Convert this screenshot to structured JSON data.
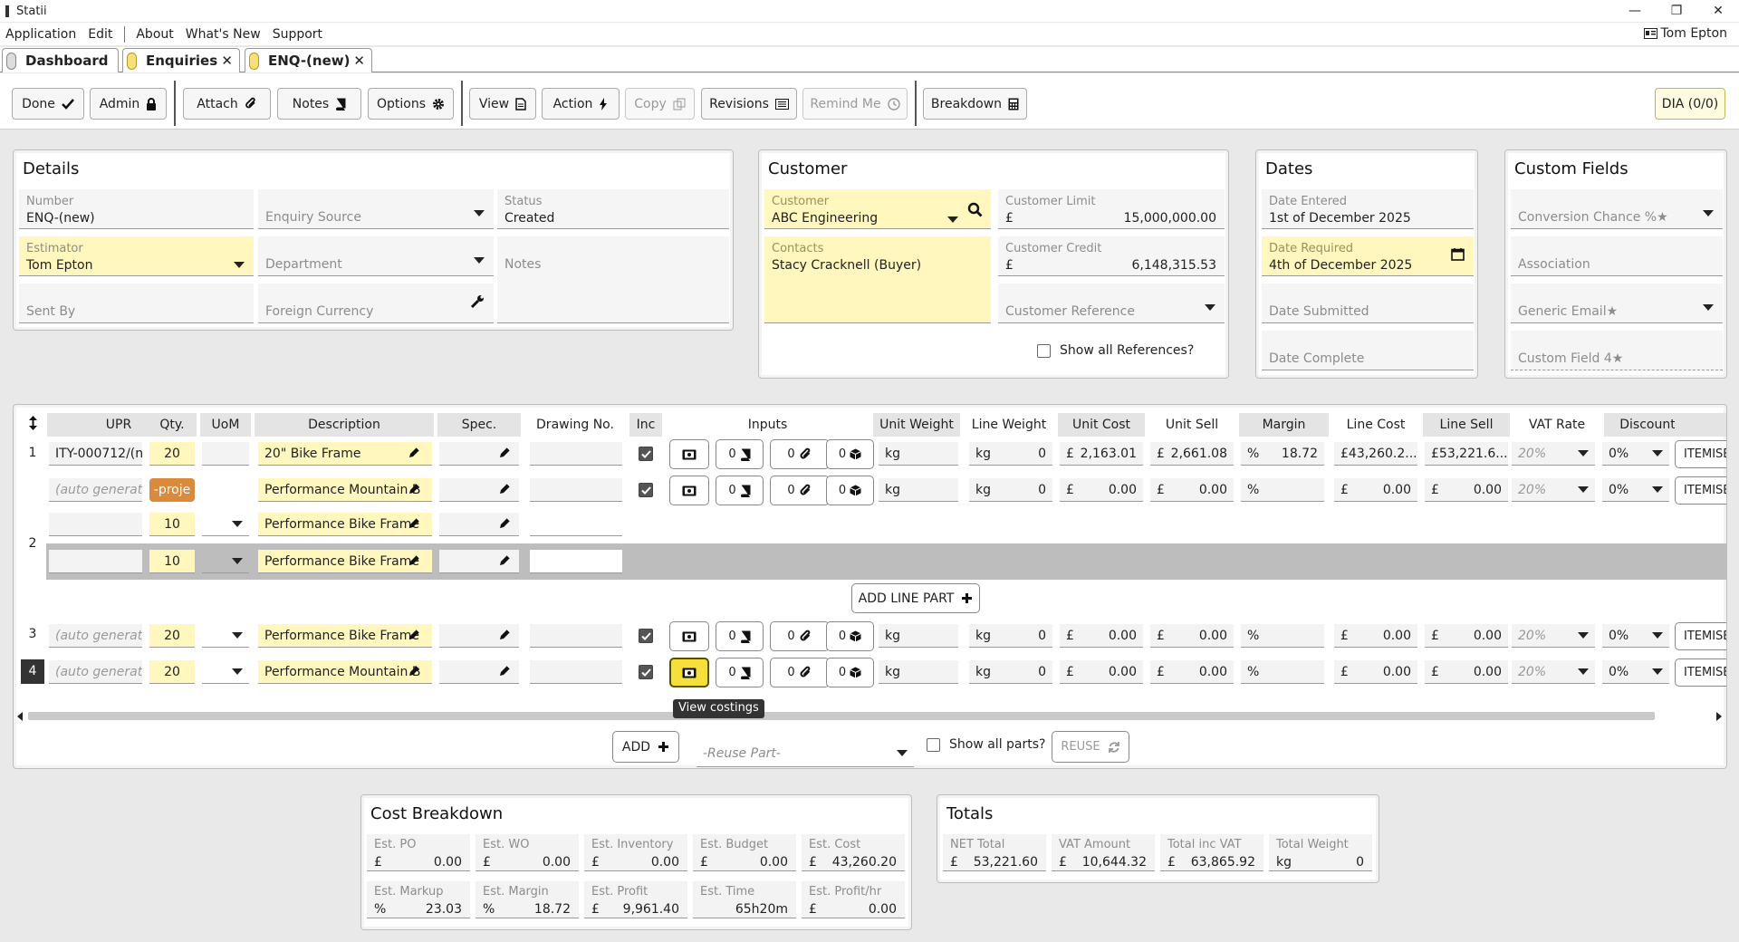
{
  "window": {
    "title": "Statii"
  },
  "menu": {
    "items": [
      "Application",
      "Edit",
      "About",
      "What's New",
      "Support"
    ],
    "user": "Tom Epton"
  },
  "tabs": [
    {
      "label": "Dashboard"
    },
    {
      "label": "Enquiries"
    },
    {
      "label": "ENQ-(new)"
    }
  ],
  "toolbar": {
    "done": "Done",
    "admin": "Admin",
    "attach": "Attach",
    "notes": "Notes",
    "options": "Options",
    "view": "View",
    "action": "Action",
    "copy": "Copy",
    "revisions": "Revisions",
    "remind": "Remind Me",
    "breakdown": "Breakdown",
    "dia": "DIA (0/0)"
  },
  "details": {
    "title": "Details",
    "number_label": "Number",
    "number": "ENQ-(new)",
    "source_ph": "Enquiry Source",
    "status_label": "Status",
    "status": "Created",
    "estimator_label": "Estimator",
    "estimator": "Tom Epton",
    "department_ph": "Department",
    "notes_ph": "Notes",
    "sentby_ph": "Sent By",
    "currency_ph": "Foreign Currency"
  },
  "customer": {
    "title": "Customer",
    "customer_label": "Customer",
    "customer": "ABC Engineering",
    "limit_label": "Customer Limit",
    "limit_cur": "£",
    "limit": "15,000,000.00",
    "contacts_label": "Contacts",
    "contacts": "Stacy Cracknell (Buyer)",
    "credit_label": "Customer Credit",
    "credit_cur": "£",
    "credit": "6,148,315.53",
    "reference_ph": "Customer Reference",
    "show_refs": "Show all References?"
  },
  "dates": {
    "title": "Dates",
    "entered_label": "Date Entered",
    "entered": "1st of December 2025",
    "required_label": "Date Required",
    "required": "4th of December 2025",
    "submitted_ph": "Date Submitted",
    "complete_ph": "Date Complete"
  },
  "custom": {
    "title": "Custom Fields",
    "f1": "Conversion Chance %★",
    "f2": "Association",
    "f3": "Generic Email★",
    "f4": "Custom Field 4★"
  },
  "grid": {
    "headers": {
      "upr": "UPR",
      "qty": "Qty.",
      "uom": "UoM",
      "desc": "Description",
      "spec": "Spec.",
      "drawing": "Drawing No.",
      "inc": "Inc",
      "inputs": "Inputs",
      "unit_weight": "Unit Weight",
      "line_weight": "Line Weight",
      "unit_cost": "Unit Cost",
      "unit_sell": "Unit Sell",
      "margin": "Margin",
      "line_cost": "Line Cost",
      "line_sell": "Line Sell",
      "vat_rate": "VAT Rate",
      "discount": "Discount"
    },
    "rows": [
      {
        "num": "1",
        "upr": "ITY-000712/(n",
        "qty": "20",
        "desc": "20\" Bike Frame",
        "uw": "kg",
        "lw_unit": "kg",
        "lw": "0",
        "cur": "£",
        "uc": "2,163.01",
        "us": "2,661.08",
        "pct": "%",
        "margin": "18.72",
        "lc": "43,260.2...",
        "ls": "53,221.6...",
        "vat": "20%",
        "disc": "0%",
        "itemise": "ITEMISE",
        "in1": "0",
        "in2": "0",
        "in3": "0"
      },
      {
        "upr": "(auto generat",
        "qty": "-proje",
        "desc": "Performance Mountain B",
        "uw": "kg",
        "lw_unit": "kg",
        "lw": "0",
        "cur": "£",
        "uc": "0.00",
        "us": "0.00",
        "pct": "%",
        "margin": "",
        "lc": "0.00",
        "ls": "0.00",
        "vat": "20%",
        "disc": "0%",
        "itemise": "ITEMISE",
        "in1": "0",
        "in2": "0",
        "in3": "0"
      },
      {
        "num": "2",
        "qty": "10",
        "desc": "Performance Bike Frame"
      },
      {
        "qty": "10",
        "desc": "Performance Bike Frame"
      },
      {
        "num": "3",
        "upr": "(auto generat",
        "qty": "20",
        "desc": "Performance Bike Frame",
        "uw": "kg",
        "lw_unit": "kg",
        "lw": "0",
        "cur": "£",
        "uc": "0.00",
        "us": "0.00",
        "pct": "%",
        "margin": "",
        "lc": "0.00",
        "ls": "0.00",
        "vat": "20%",
        "disc": "0%",
        "itemise": "ITEMISE",
        "in1": "0",
        "in2": "0",
        "in3": "0"
      },
      {
        "num": "4",
        "upr": "(auto generat",
        "qty": "20",
        "desc": "Performance Mountain B",
        "uw": "kg",
        "lw_unit": "kg",
        "lw": "0",
        "cur": "£",
        "uc": "0.00",
        "us": "0.00",
        "pct": "%",
        "margin": "",
        "lc": "0.00",
        "ls": "0.00",
        "vat": "20%",
        "disc": "0%",
        "itemise": "ITEMISE",
        "in1": "0",
        "in2": "0",
        "in3": "0"
      }
    ],
    "add_line_part": "ADD LINE PART",
    "tooltip": "View costings",
    "add": "ADD",
    "reuse_ph": "-Reuse Part-",
    "show_all_parts": "Show all parts?",
    "reuse": "REUSE"
  },
  "cost_breakdown": {
    "title": "Cost Breakdown",
    "items": [
      {
        "label": "Est. PO",
        "cur": "£",
        "value": "0.00"
      },
      {
        "label": "Est. WO",
        "cur": "£",
        "value": "0.00"
      },
      {
        "label": "Est. Inventory",
        "cur": "£",
        "value": "0.00"
      },
      {
        "label": "Est. Budget",
        "cur": "£",
        "value": "0.00"
      },
      {
        "label": "Est. Cost",
        "cur": "£",
        "value": "43,260.20"
      },
      {
        "label": "Est. Markup",
        "cur": "%",
        "value": "23.03"
      },
      {
        "label": "Est. Margin",
        "cur": "%",
        "value": "18.72"
      },
      {
        "label": "Est. Profit",
        "cur": "£",
        "value": "9,961.40"
      },
      {
        "label": "Est. Time",
        "cur": "",
        "value": "65h20m"
      },
      {
        "label": "Est. Profit/hr",
        "cur": "£",
        "value": "0.00"
      }
    ]
  },
  "totals": {
    "title": "Totals",
    "items": [
      {
        "label": "NET Total",
        "cur": "£",
        "value": "53,221.60"
      },
      {
        "label": "VAT Amount",
        "cur": "£",
        "value": "10,644.32"
      },
      {
        "label": "Total inc VAT",
        "cur": "£",
        "value": "63,865.92"
      },
      {
        "label": "Total Weight",
        "cur": "kg",
        "value": "0"
      }
    ]
  },
  "colors": {
    "highlight": "#fff7bd",
    "accent": "#f5df3a",
    "project": "#d98a3c"
  }
}
